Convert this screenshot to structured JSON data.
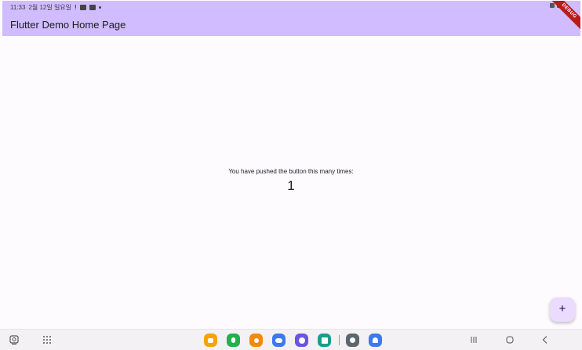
{
  "status_bar": {
    "time": "11:33",
    "date": "2월 12일 일요일"
  },
  "app_bar": {
    "title": "Flutter Demo Home Page",
    "debug_banner": "DEBUG",
    "color": "#d0bcff"
  },
  "counter": {
    "label": "You have pushed the button this many times:",
    "value": "1"
  },
  "fab": {
    "icon": "+",
    "color": "#ebdcff"
  },
  "nav_bar": {
    "left_icons": [
      "screenshot-icon",
      "app-drawer-icon"
    ],
    "apps": [
      {
        "name": "my-files-icon",
        "color": "#f5a30a"
      },
      {
        "name": "phone-icon",
        "color": "#22b14c"
      },
      {
        "name": "contacts-icon",
        "color": "#f5890a"
      },
      {
        "name": "messages-icon",
        "color": "#3c78f0"
      },
      {
        "name": "internet-icon",
        "color": "#6a55e0"
      },
      {
        "name": "calendar-icon",
        "color": "#1a9e8a"
      },
      {
        "name": "settings-icon",
        "color": "#5b6770"
      },
      {
        "name": "headset-icon",
        "color": "#3c78f0"
      }
    ],
    "system_buttons": [
      "recents-icon",
      "home-icon",
      "back-icon"
    ]
  }
}
